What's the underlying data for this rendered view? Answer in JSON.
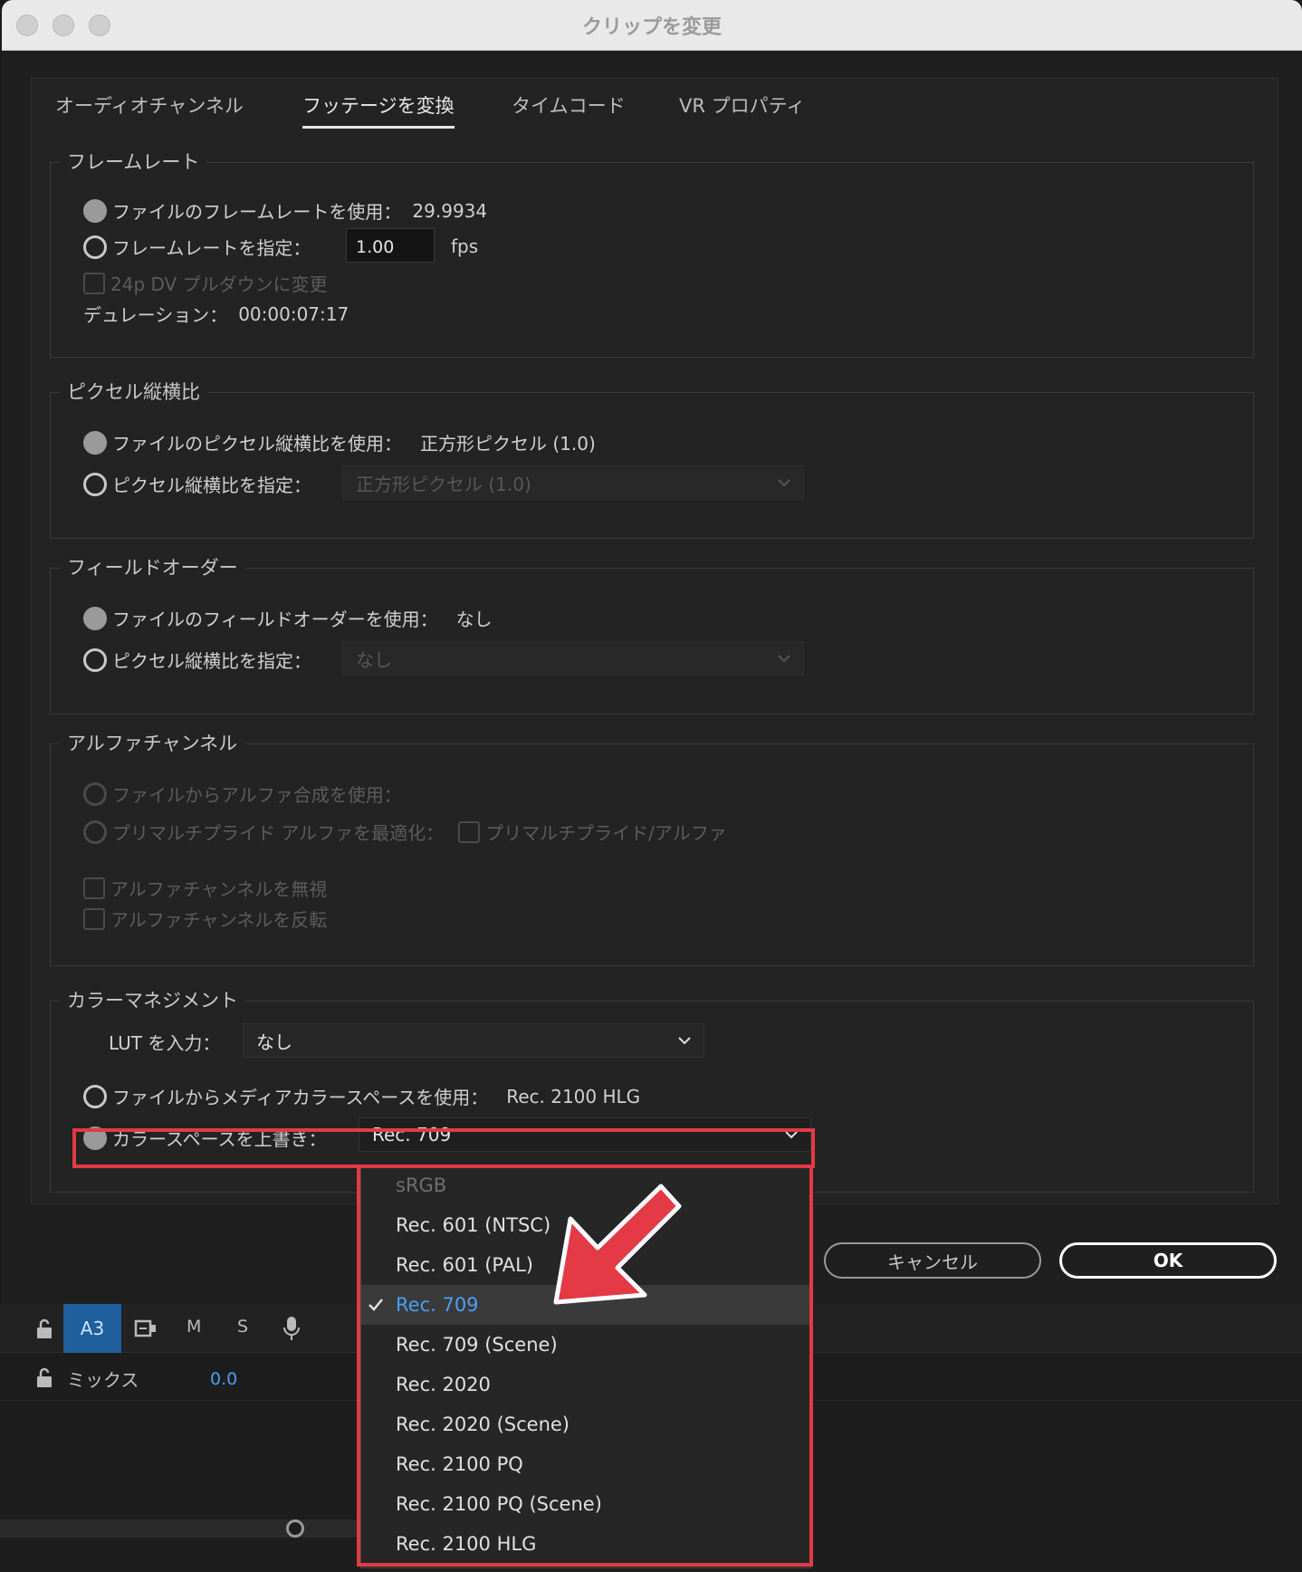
{
  "window": {
    "title": "クリップを変更"
  },
  "tabs": [
    "オーディオチャンネル",
    "フッテージを変換",
    "タイムコード",
    "VR プロパティ"
  ],
  "frame_rate": {
    "label": "フレームレート",
    "use_file_label": "ファイルのフレームレートを使用：",
    "use_file_value": "29.9934",
    "assume_label": "フレームレートを指定：",
    "assume_value": "1.00",
    "fps_unit": "fps",
    "pulldown_label": "24p DV プルダウンに変更",
    "duration_label": "デュレーション：",
    "duration_value": "00:00:07:17"
  },
  "pixel_aspect": {
    "label": "ピクセル縦横比",
    "use_file_label": "ファイルのピクセル縦横比を使用：",
    "use_file_value": "正方形ピクセル (1.0)",
    "conform_label": "ピクセル縦横比を指定：",
    "conform_value": "正方形ピクセル (1.0)"
  },
  "field_order": {
    "label": "フィールドオーダー",
    "use_file_label": "ファイルのフィールドオーダーを使用：",
    "use_file_value": "なし",
    "conform_label": "ピクセル縦横比を指定：",
    "conform_value": "なし"
  },
  "alpha": {
    "label": "アルファチャンネル",
    "use_file_label": "ファイルからアルファ合成を使用：",
    "premultiplied_label": "プリマルチプライド アルファを最適化：",
    "premultiplied_check_label": "プリマルチプライド/アルファ",
    "ignore_label": "アルファチャンネルを無視",
    "invert_label": "アルファチャンネルを反転"
  },
  "color": {
    "label": "カラーマネジメント",
    "lut_label": "LUT を入力：",
    "lut_value": "なし",
    "use_file_label": "ファイルからメディアカラースペースを使用：",
    "use_file_value": "Rec. 2100 HLG",
    "override_label": "カラースペースを上書き：",
    "override_value": "Rec. 709"
  },
  "buttons": {
    "cancel": "キャンセル",
    "ok": "OK"
  },
  "timeline": {
    "track_name": "A3",
    "mute": "M",
    "solo": "S",
    "mix_label": "ミックス",
    "mix_value": "0.0"
  },
  "colorspace_menu": {
    "items": [
      "sRGB",
      "Rec. 601 (NTSC)",
      "Rec. 601 (PAL)",
      "Rec. 709",
      "Rec. 709 (Scene)",
      "Rec. 2020",
      "Rec. 2020 (Scene)",
      "Rec. 2100 PQ",
      "Rec. 2100 PQ (Scene)",
      "Rec. 2100 HLG"
    ],
    "selected": "Rec. 709",
    "disabled": "sRGB"
  },
  "colors": {
    "highlight": "#e33a45",
    "selected_text": "#4a9ff5",
    "track_button": "#1f5f9e"
  },
  "icons": [
    "lock-icon",
    "track-output-icon",
    "microphone-icon",
    "checkmark-icon",
    "chevron-down-icon",
    "arrow-annotation-icon"
  ]
}
